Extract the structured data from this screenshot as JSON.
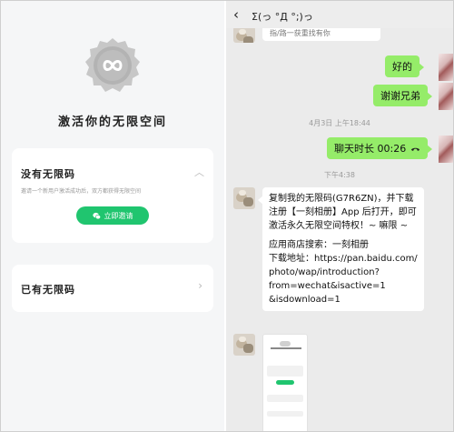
{
  "left_panel": {
    "title": "激活你的无限空间",
    "no_code": {
      "label": "没有无限码",
      "description": "邀请一个新用户激活成功后，双方都获得无限空间",
      "button_label": "立即邀请"
    },
    "has_code": {
      "label": "已有无限码"
    }
  },
  "chat": {
    "title": "Σ(っ °Д °;)っ",
    "truncated_text": "指/路一获重找有你",
    "messages": {
      "ok": "好的",
      "thanks": "谢谢兄弟",
      "time1": "4月3日 上午18:44",
      "call": "聊天时长 00:26",
      "time2": "下午4:38",
      "share_lines": [
        "复制我的无限码(G7R6ZN)，并下载",
        "注册【一刻相册】App 后打开，即可",
        "激活永久无限空间特权！~ 嘛限 ~",
        "",
        "应用商店搜索：一刻相册",
        "下载地址：https://pan.baidu.com/",
        "photo/wap/introduction?",
        "from=wechat&isactive=1",
        "&isdownload=1"
      ]
    }
  },
  "colors": {
    "wechat_green_bubble": "#95ec69",
    "button_green": "#20c56f",
    "chat_background": "#ebebeb"
  }
}
